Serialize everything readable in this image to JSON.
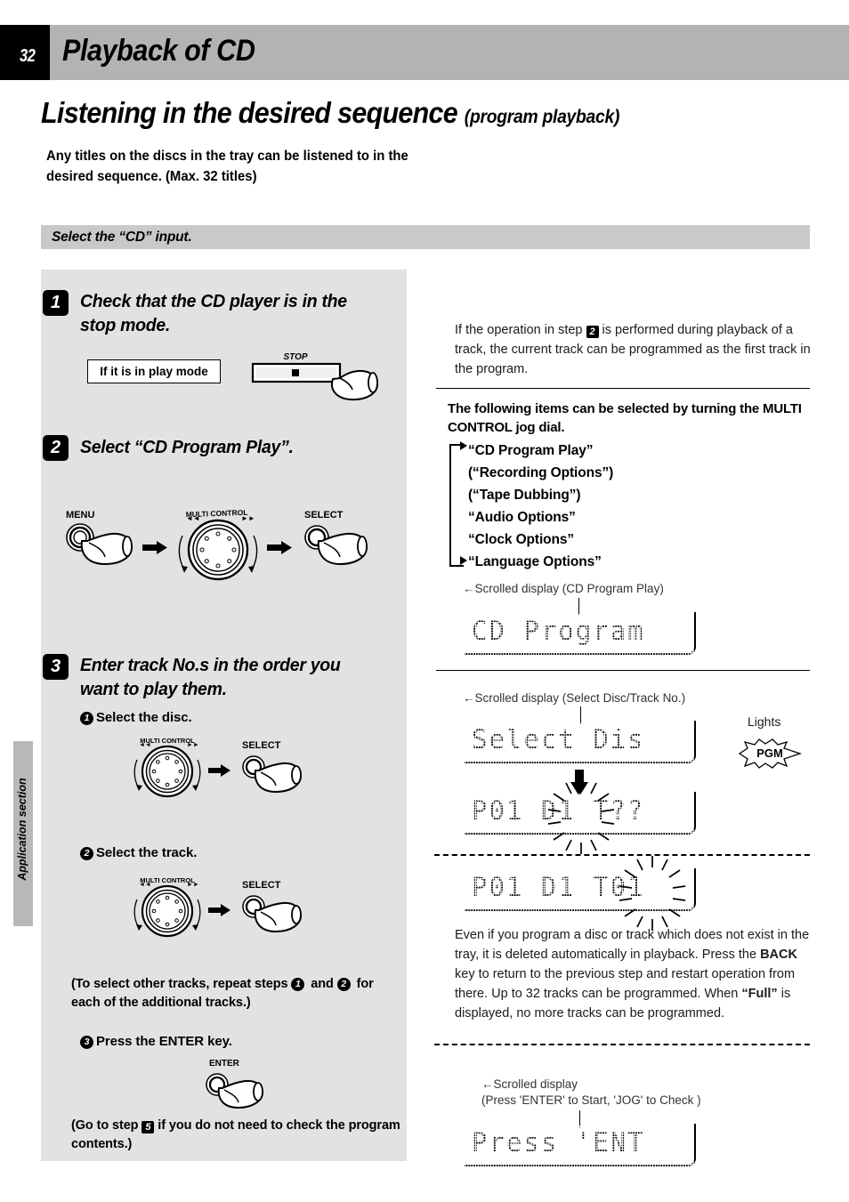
{
  "header": {
    "page_number": "32",
    "title": "Playback of CD"
  },
  "main": {
    "title": "Listening in the desired sequence",
    "title_sub": "(program playback)",
    "intro": "Any titles on the discs in the tray can be listened to in the desired sequence. (Max. 32 titles)",
    "section_bar_label": "Select the “CD” input."
  },
  "side_tab": {
    "label": "Application section"
  },
  "steps": [
    {
      "number": "1",
      "heading": "Check that the CD player is in the stop mode.",
      "callout": "If it is in play mode",
      "button_label": "STOP"
    },
    {
      "number": "2",
      "heading": "Select “CD Program Play”.",
      "controls": [
        "MENU",
        "MULTI CONTROL",
        "SELECT"
      ]
    },
    {
      "number": "3",
      "heading": "Enter track No.s in the order you want to play them.",
      "substeps": [
        {
          "num": "1",
          "label": "Select the disc.",
          "control": "SELECT",
          "dial": "MULTI CONTROL"
        },
        {
          "num": "2",
          "label": "Select the track.",
          "control": "SELECT",
          "dial": "MULTI CONTROL"
        },
        {
          "num": "3",
          "label": "Press the ENTER key.",
          "control": "ENTER"
        }
      ],
      "repeat_note_a": "(To select other tracks, repeat steps ",
      "repeat_note_b": " and ",
      "repeat_note_c": " for each of the additional tracks.)",
      "goto_note_a": "(Go to step ",
      "goto_note_b": " if you do not need to check the program contents.)",
      "goto_ref": "5"
    }
  ],
  "right": {
    "note1_a": "If the operation in step ",
    "note1_ref": "2",
    "note1_b": " is performed during playback of a track, the current track can be programmed as the first track in the program.",
    "jog_intro": "The following items can be selected by turning the MULTI CONTROL jog dial.",
    "menu_items": [
      "“CD Program Play”",
      "(“Recording Options”)",
      "(“Tape Dubbing”)",
      "“Audio Options”",
      "“Clock Options”",
      "“Language Options”"
    ],
    "scroll_label_1": "←Scrolled display (CD Program Play)",
    "lcd_1": "CD Program",
    "scroll_label_2": "←Scrolled display (Select Disc/Track No.)",
    "lcd_2": "Select Dis",
    "lcd_3": "P01 D1 T??",
    "lcd_4": "P01 D1 T01",
    "lights_label": "Lights",
    "pgm_indicator": "PGM",
    "note2_line1": "Even if you program a disc or track which does not exist in the tray, it is deleted automatically in playback.",
    "note2_line2_a": "Press the ",
    "note2_line2_bold": "BACK",
    "note2_line2_b": " key to return to the previous step and restart operation from there.",
    "note2_line3_a": "Up to 32 tracks can be programmed. When ",
    "note2_line3_bold": "“Full”",
    "note2_line3_b": " is displayed, no more tracks can be programmed.",
    "scroll_label_3_line1": "←Scrolled display",
    "scroll_label_3_line2": "(Press 'ENTER' to Start, 'JOG' to Check )",
    "lcd_5": "Press 'ENT"
  }
}
